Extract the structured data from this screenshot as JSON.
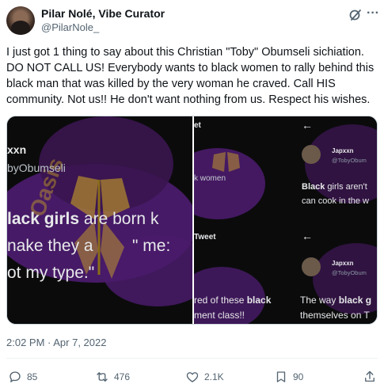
{
  "author": {
    "display_name": "Pilar Nolé, Vibe Curator",
    "handle": "@PilarNole_"
  },
  "tweet": {
    "text": "I just got 1 thing to say about this Christian \"Toby\" Obumseli sichiation. DO NOT CALL US! Everybody wants to black women to rally behind this black man that was killed by the very woman he craved. Call HIS community. Not us!! He don't want nothing from us. Respect his wishes.",
    "timestamp": "2:02 PM · Apr 7, 2022"
  },
  "media": {
    "left": {
      "top_name": "xxn",
      "top_handle": "byObumseli",
      "line1_bold": "lack girls",
      "line1_rest": " are born k",
      "line2": "nake they a",
      "line2_end": "\" me:",
      "line3": "ot my type.\"",
      "watermark": "Oasis"
    },
    "right": {
      "frag_et": "et",
      "frag_k_women": "k women",
      "frag_tweet": "Tweet",
      "frag_red": "red of these ",
      "frag_black": "black",
      "frag_ment": "ment class!!",
      "back_arrow": "←",
      "card1_name": "Japxxn",
      "card1_handle": "@TobyObum",
      "card1_bold": "Black",
      "card1_line1": " girls aren't",
      "card1_line2": "can cook in the w",
      "card2_name": "Japxxn",
      "card2_handle": "@TobyObum",
      "card2_line1_pre": "The way ",
      "card2_bold": "black g",
      "card2_line2": "themselves on T"
    }
  },
  "actions": {
    "replies": "85",
    "retweets": "476",
    "likes": "2.1K",
    "bookmarks": "90"
  },
  "icons": {
    "grok": "grok-icon",
    "more": "more-icon",
    "reply": "reply-icon",
    "retweet": "retweet-icon",
    "like": "heart-icon",
    "bookmark": "bookmark-icon",
    "share": "share-icon"
  },
  "colors": {
    "text": "#0f1419",
    "secondary": "#536471",
    "media_purple": "#4a1b6b",
    "media_gold": "#c9a227"
  }
}
